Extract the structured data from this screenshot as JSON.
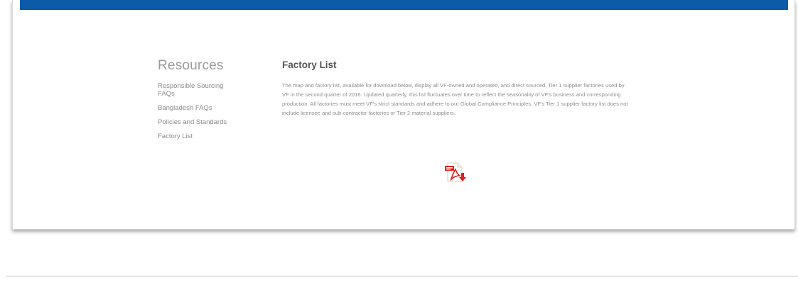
{
  "sidebar": {
    "title": "Resources",
    "items": [
      {
        "label": "Responsible Sourcing FAQs"
      },
      {
        "label": "Bangladesh FAQs"
      },
      {
        "label": "Policies and Standards"
      },
      {
        "label": "Factory List"
      }
    ]
  },
  "main": {
    "title": "Factory List",
    "body": "The map and factory list, available for download below, display all VF-owned and operated, and direct sourced, Tier 1 supplier factories used by VF in the second quarter of 2016. Updated quarterly, this list fluctuates over time to reflect the seasonality of VF's business and corresponding production. All factories must meet VF's strict standards and adhere to our Global Compliance Principles. VF's Tier 1 supplier factory list does not include licensee and sub-contractor factories or Tier 2 material suppliers.",
    "download_icon": "pdf-download-icon"
  },
  "colors": {
    "header_bar": "#0b5ba8",
    "pdf_red": "#e0201b",
    "text_muted": "#8e8e8e"
  }
}
